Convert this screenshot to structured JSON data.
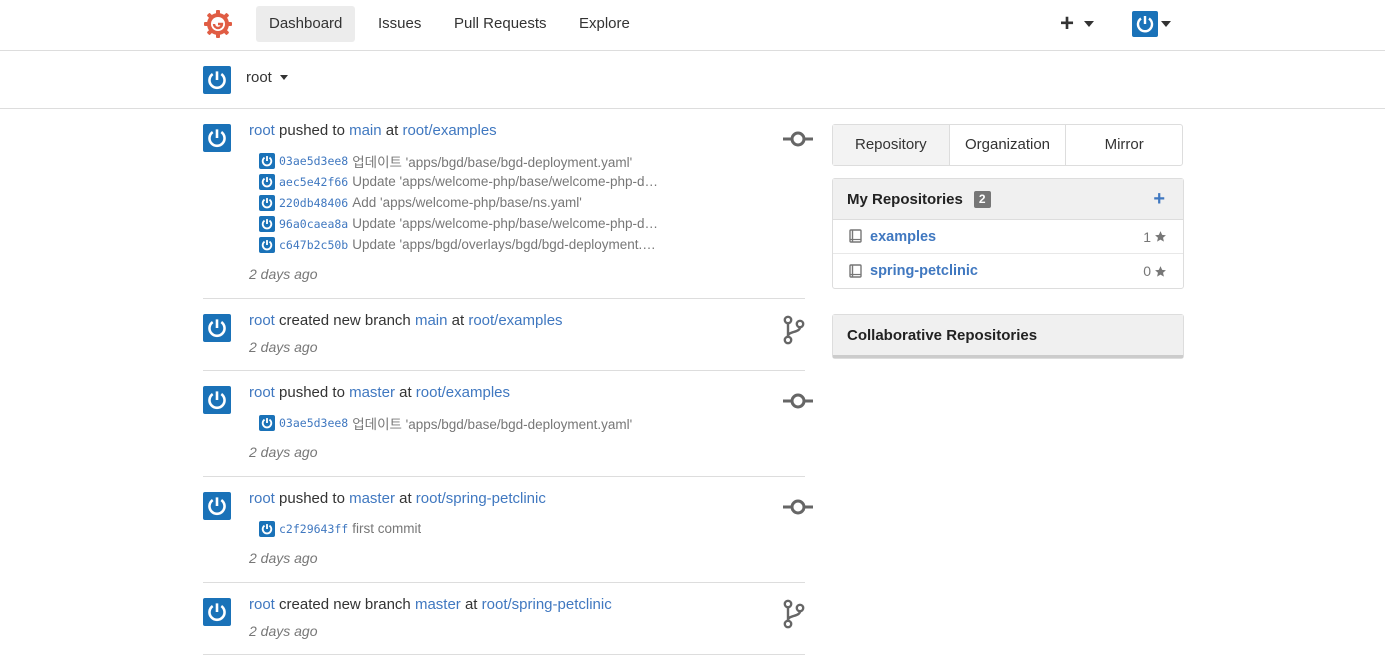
{
  "nav": {
    "items": [
      {
        "label": "Dashboard",
        "active": true
      },
      {
        "label": "Issues"
      },
      {
        "label": "Pull Requests"
      },
      {
        "label": "Explore"
      }
    ],
    "plus": "+"
  },
  "context": {
    "name": "root"
  },
  "feed": [
    {
      "user": "root",
      "action": "pushed to",
      "ref": "main",
      "at": "at",
      "repo": "root/examples",
      "icon": "commit-icon",
      "commits": [
        {
          "sha": "03ae5d3ee8",
          "message": "업데이트 'apps/bgd/base/bgd-deployment.yaml'"
        },
        {
          "sha": "aec5e42f66",
          "message": "Update 'apps/welcome-php/base/welcome-php-deployment.yaml'"
        },
        {
          "sha": "220db48406",
          "message": "Add 'apps/welcome-php/base/ns.yaml'"
        },
        {
          "sha": "96a0caea8a",
          "message": "Update 'apps/welcome-php/base/welcome-php-deployment.yaml'"
        },
        {
          "sha": "c647b2c50b",
          "message": "Update 'apps/bgd/overlays/bgd/bgd-deployment.yaml'"
        }
      ],
      "time": "2 days ago"
    },
    {
      "user": "root",
      "action": "created new branch",
      "ref": "main",
      "at": "at",
      "repo": "root/examples",
      "icon": "branch-icon",
      "commits": [],
      "time": "2 days ago"
    },
    {
      "user": "root",
      "action": "pushed to",
      "ref": "master",
      "at": "at",
      "repo": "root/examples",
      "icon": "commit-icon",
      "commits": [
        {
          "sha": "03ae5d3ee8",
          "message": "업데이트 'apps/bgd/base/bgd-deployment.yaml'"
        }
      ],
      "time": "2 days ago"
    },
    {
      "user": "root",
      "action": "pushed to",
      "ref": "master",
      "at": "at",
      "repo": "root/spring-petclinic",
      "icon": "commit-icon",
      "commits": [
        {
          "sha": "c2f29643ff",
          "message": "first commit"
        }
      ],
      "time": "2 days ago"
    },
    {
      "user": "root",
      "action": "created new branch",
      "ref": "master",
      "at": "at",
      "repo": "root/spring-petclinic",
      "icon": "branch-icon",
      "commits": [],
      "time": "2 days ago"
    }
  ],
  "sidebar": {
    "tabs": [
      "Repository",
      "Organization",
      "Mirror"
    ],
    "my_repos": {
      "title": "My Repositories",
      "count": "2",
      "add": "+",
      "items": [
        {
          "name": "examples",
          "stars": "1"
        },
        {
          "name": "spring-petclinic",
          "stars": "0"
        }
      ]
    },
    "collab_title": "Collaborative Repositories"
  },
  "colors": {
    "accent": "#4078c0",
    "avatar": "#1a72b8",
    "logo": "#e05d44"
  }
}
